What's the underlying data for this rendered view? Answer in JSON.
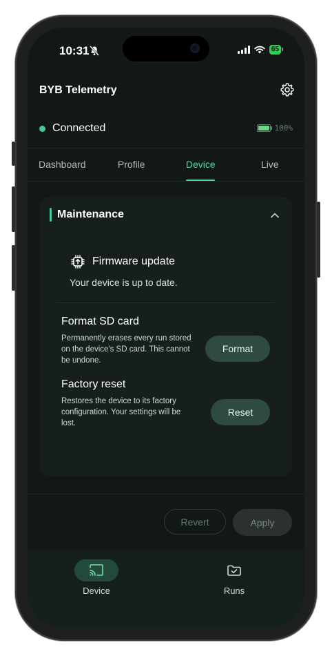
{
  "status_bar": {
    "time": "10:31",
    "battery": "65"
  },
  "app": {
    "title": "BYB Telemetry"
  },
  "connection": {
    "status": "Connected",
    "battery_percent": "100%"
  },
  "tabs": [
    {
      "label": "Dashboard"
    },
    {
      "label": "Profile"
    },
    {
      "label": "Device"
    },
    {
      "label": "Live"
    }
  ],
  "active_tab": "Device",
  "maintenance": {
    "title": "Maintenance",
    "firmware": {
      "title": "Firmware update",
      "status": "Your device is up to date."
    },
    "format": {
      "title": "Format SD card",
      "description": "Permanently erases every run stored on the device's SD card. This cannot be undone.",
      "button": "Format"
    },
    "reset": {
      "title": "Factory reset",
      "description": "Restores the device to its factory configuration. Your settings will be lost.",
      "button": "Reset"
    }
  },
  "footer": {
    "revert": "Revert",
    "apply": "Apply"
  },
  "bottom_nav": [
    {
      "label": "Device",
      "icon": "cast-icon"
    },
    {
      "label": "Runs",
      "icon": "folder-check-icon"
    }
  ],
  "colors": {
    "accent": "#46c994",
    "background": "#111816",
    "card": "#161f1c",
    "button": "#2f4a3e"
  }
}
